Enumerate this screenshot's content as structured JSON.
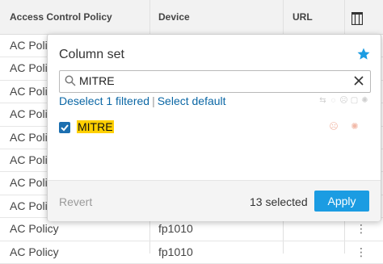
{
  "table": {
    "columns": {
      "policy": "Access Control Policy",
      "device": "Device",
      "url": "URL"
    },
    "rows": [
      {
        "policy": "AC Polic",
        "device": "",
        "menu": ""
      },
      {
        "policy": "AC Polic",
        "device": "",
        "menu": ""
      },
      {
        "policy": "AC Polic",
        "device": "",
        "menu": ""
      },
      {
        "policy": "AC Polic",
        "device": "",
        "menu": ""
      },
      {
        "policy": "AC Polic",
        "device": "",
        "menu": ""
      },
      {
        "policy": "AC Polic",
        "device": "",
        "menu": ""
      },
      {
        "policy": "AC Polic",
        "device": "",
        "menu": ""
      },
      {
        "policy": "AC Polic",
        "device": "",
        "menu": ""
      },
      {
        "policy": "AC Policy",
        "device": "fp1010",
        "menu": "⋮"
      },
      {
        "policy": "AC Policy",
        "device": "fp1010",
        "menu": "⋮"
      }
    ]
  },
  "popover": {
    "title": "Column set",
    "search_value": "MITRE",
    "deselect_label": "Deselect 1 filtered",
    "select_default_label": "Select default",
    "item_label": "MITRE",
    "revert_label": "Revert",
    "selected_count": "13 selected",
    "apply_label": "Apply"
  },
  "icons": [
    "column-chooser-icon",
    "star-icon",
    "search-icon",
    "clear-icon",
    "checkbox-checked-icon",
    "kebab-icon"
  ],
  "colors": {
    "accent": "#1b9ce2",
    "link": "#0b67a5",
    "highlight": "#ffd000",
    "checkbox": "#1c6fb0"
  }
}
